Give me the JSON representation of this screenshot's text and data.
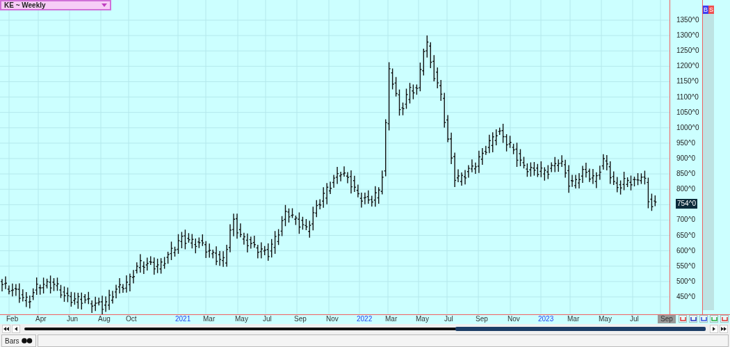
{
  "symbol_selector": {
    "label": "KE ~ Weekly"
  },
  "order_buttons": [
    {
      "label": "B",
      "kind": "buy"
    },
    {
      "label": "S",
      "kind": "sell"
    }
  ],
  "price_axis": {
    "labels": [
      "1350^0",
      "1300^0",
      "1250^0",
      "1200^0",
      "1150^0",
      "1100^0",
      "1050^0",
      "1000^0",
      "950^0",
      "900^0",
      "850^0",
      "800^0",
      "700^0",
      "650^0",
      "600^0",
      "550^0",
      "500^0",
      "450^0"
    ],
    "last_price": "754^0"
  },
  "time_axis": [
    {
      "label": "Feb",
      "kind": "month",
      "current": false
    },
    {
      "label": "Apr",
      "kind": "month",
      "current": false
    },
    {
      "label": "Jun",
      "kind": "month",
      "current": false
    },
    {
      "label": "Aug",
      "kind": "month",
      "current": false
    },
    {
      "label": "Oct",
      "kind": "month",
      "current": false
    },
    {
      "label": "2021",
      "kind": "year",
      "current": false
    },
    {
      "label": "Mar",
      "kind": "month",
      "current": false
    },
    {
      "label": "May",
      "kind": "month",
      "current": false
    },
    {
      "label": "Jul",
      "kind": "month",
      "current": false
    },
    {
      "label": "Sep",
      "kind": "month",
      "current": false
    },
    {
      "label": "Nov",
      "kind": "month",
      "current": false
    },
    {
      "label": "2022",
      "kind": "year",
      "current": false
    },
    {
      "label": "Mar",
      "kind": "month",
      "current": false
    },
    {
      "label": "May",
      "kind": "month",
      "current": false
    },
    {
      "label": "Jul",
      "kind": "month",
      "current": false
    },
    {
      "label": "Sep",
      "kind": "month",
      "current": false
    },
    {
      "label": "Nov",
      "kind": "month",
      "current": false
    },
    {
      "label": "2023",
      "kind": "year",
      "current": false
    },
    {
      "label": "Mar",
      "kind": "month",
      "current": false
    },
    {
      "label": "May",
      "kind": "month",
      "current": false
    },
    {
      "label": "Jul",
      "kind": "month",
      "current": false
    },
    {
      "label": "Sep",
      "kind": "month",
      "current": true
    }
  ],
  "status_bar": {
    "tab": "Bars"
  }
}
